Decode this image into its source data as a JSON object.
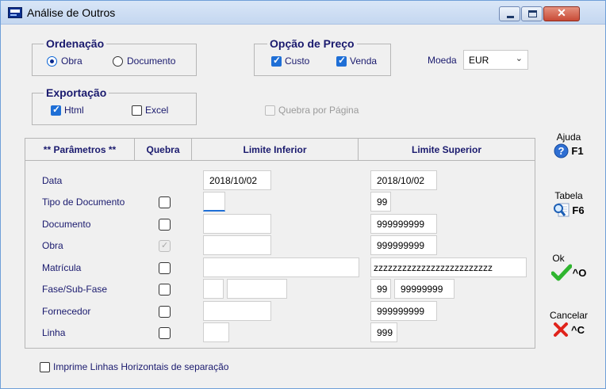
{
  "window": {
    "title": "Análise de Outros"
  },
  "ordenacao": {
    "label": "Ordenação",
    "options": [
      "Obra",
      "Documento"
    ],
    "selected": "Obra"
  },
  "opcao_preco": {
    "label": "Opção de Preço",
    "custo": "Custo",
    "venda": "Venda",
    "custo_checked": true,
    "venda_checked": true
  },
  "moeda": {
    "label": "Moeda",
    "value": "EUR"
  },
  "exportacao": {
    "label": "Exportação",
    "html": "Html",
    "excel": "Excel",
    "html_checked": true,
    "excel_checked": false
  },
  "quebra_pagina": {
    "label": "Quebra por Página",
    "checked": false,
    "enabled": false
  },
  "params": {
    "headers": {
      "param": "** Parâmetros **",
      "quebra": "Quebra",
      "inferior": "Limite Inferior",
      "superior": "Limite Superior"
    },
    "rows": [
      {
        "label": "Data",
        "inf": "2018/10/02",
        "sup": "2018/10/02"
      },
      {
        "label": "Tipo de Documento",
        "inf": "",
        "sup": "99"
      },
      {
        "label": "Documento",
        "inf": "",
        "sup": "999999999"
      },
      {
        "label": "Obra",
        "inf": "",
        "sup": "999999999"
      },
      {
        "label": "Matrícula",
        "inf": "",
        "sup": "zzzzzzzzzzzzzzzzzzzzzzzzz"
      },
      {
        "label": "Fase/Sub-Fase",
        "inf": "",
        "inf2": "",
        "sup": "99",
        "sup2": "99999999"
      },
      {
        "label": "Fornecedor",
        "inf": "",
        "sup": "999999999"
      },
      {
        "label": "Linha",
        "inf": "",
        "sup": "999"
      }
    ]
  },
  "side": {
    "ajuda": {
      "label": "Ajuda",
      "key": "F1"
    },
    "tabela": {
      "label": "Tabela",
      "key": "F6"
    },
    "ok": {
      "label": "Ok",
      "key": "^O"
    },
    "cancelar": {
      "label": "Cancelar",
      "key": "^C"
    }
  },
  "imprime": {
    "label": "Imprime Linhas Horizontais de separação",
    "checked": false
  },
  "colors": {
    "accent": "#1f6fd6",
    "label_text": "#1a1a6e",
    "ok_green": "#2fb52f",
    "cancel_red": "#e0231b"
  }
}
